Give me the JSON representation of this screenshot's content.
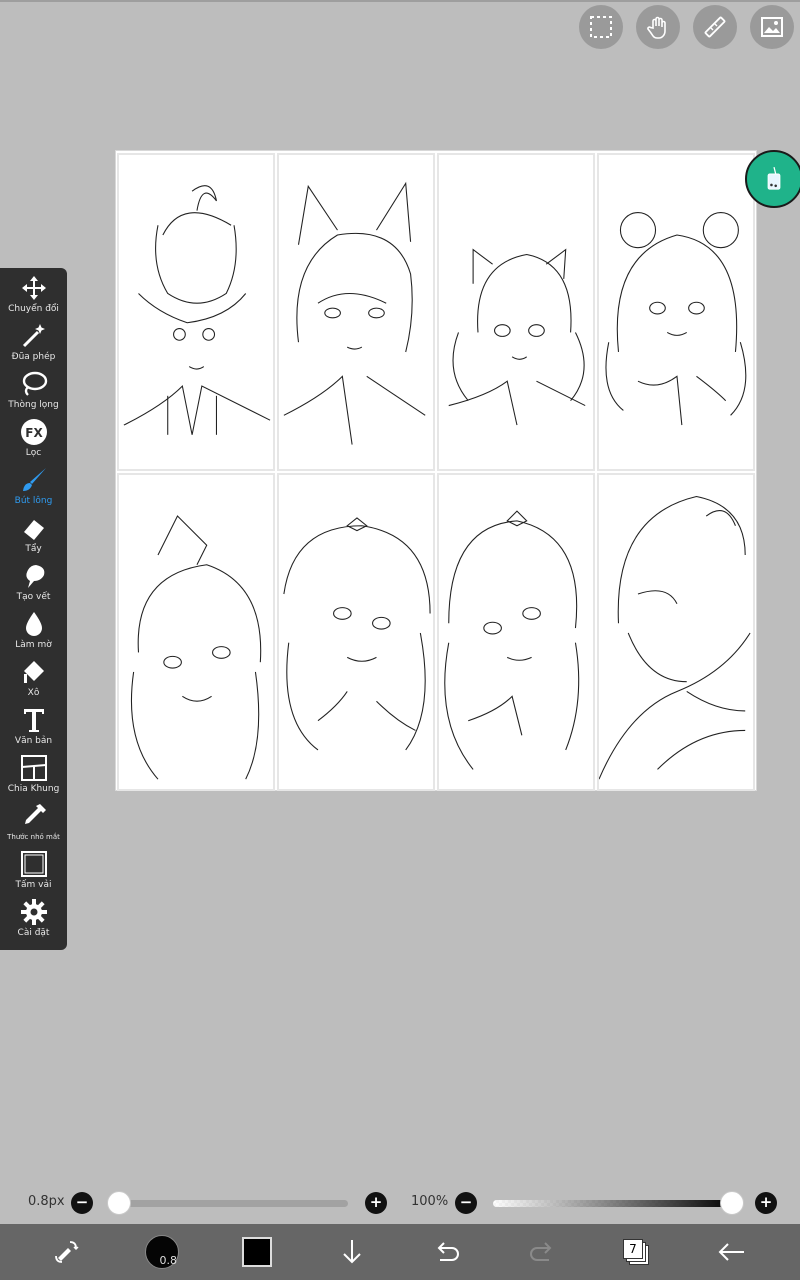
{
  "toolbar": {
    "items": [
      {
        "label": "Chuyển đổi",
        "icon": "move-icon"
      },
      {
        "label": "Đũa phép",
        "icon": "magic-wand-icon"
      },
      {
        "label": "Thòng lọng",
        "icon": "lasso-icon"
      },
      {
        "label": "Lọc",
        "icon": "fx-filter-icon"
      },
      {
        "label": "Bút lông",
        "icon": "brush-icon"
      },
      {
        "label": "Tẩy",
        "icon": "eraser-icon"
      },
      {
        "label": "Tạo vết",
        "icon": "smudge-icon"
      },
      {
        "label": "Làm mờ",
        "icon": "blur-drop-icon"
      },
      {
        "label": "Xô",
        "icon": "bucket-icon"
      },
      {
        "label": "Văn bản",
        "icon": "text-icon"
      },
      {
        "label": "Chia Khung",
        "icon": "frame-divider-icon"
      },
      {
        "label": "Thước nhỏ mắt",
        "icon": "eyedropper-icon"
      },
      {
        "label": "Tấm vải",
        "icon": "canvas-icon"
      },
      {
        "label": "Cài đặt",
        "icon": "settings-gear-icon"
      }
    ],
    "active_index": 4,
    "active_color": "#2f9bf0"
  },
  "top_tools": [
    "selection-icon",
    "hand-icon",
    "ruler-icon",
    "image-icon"
  ],
  "sliders": {
    "size_label": "0.8px",
    "size_value": 0.0,
    "opacity_label": "100%",
    "opacity_value": 1.0,
    "minus": "−",
    "plus": "+"
  },
  "bottom_bar": {
    "brush_size": "0.8",
    "color": "#000000",
    "layer_count": "7",
    "icons": [
      "transform-swap-icon",
      "brush-size-icon",
      "color-swatch",
      "download-arrow-icon",
      "undo-icon",
      "redo-icon",
      "layers-icon",
      "back-arrow-icon"
    ]
  },
  "canvas": {
    "background": "#ffffff",
    "panels": 8
  }
}
